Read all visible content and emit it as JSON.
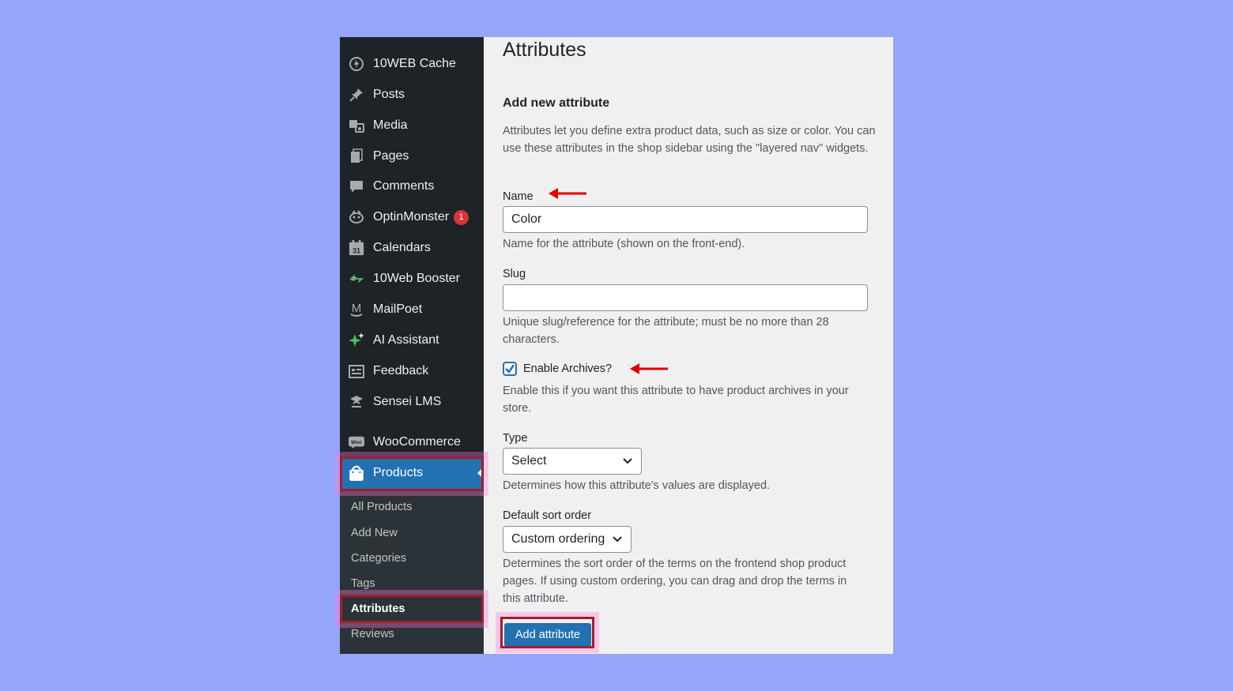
{
  "sidebar": {
    "items": [
      {
        "label": "10WEB Cache",
        "icon": "gauge-icon"
      },
      {
        "label": "Posts",
        "icon": "pin-icon"
      },
      {
        "label": "Media",
        "icon": "media-icon"
      },
      {
        "label": "Pages",
        "icon": "pages-icon"
      },
      {
        "label": "Comments",
        "icon": "comment-icon"
      },
      {
        "label": "OptinMonster",
        "icon": "optinmonster-icon",
        "badge": "1"
      },
      {
        "label": "Calendars",
        "icon": "calendar-icon",
        "icon_text": "31"
      },
      {
        "label": "10Web Booster",
        "icon": "booster-icon"
      },
      {
        "label": "MailPoet",
        "icon": "mailpoet-icon",
        "icon_text": "M"
      },
      {
        "label": "AI Assistant",
        "icon": "sparkle-icon"
      },
      {
        "label": "Feedback",
        "icon": "feedback-icon"
      },
      {
        "label": "Sensei LMS",
        "icon": "sensei-icon"
      },
      {
        "label": "WooCommerce",
        "icon": "woocommerce-icon",
        "icon_text": "Woo"
      }
    ],
    "active": {
      "label": "Products",
      "icon": "bag-icon"
    },
    "submenu": [
      {
        "label": "All Products"
      },
      {
        "label": "Add New"
      },
      {
        "label": "Categories"
      },
      {
        "label": "Tags"
      },
      {
        "label": "Attributes",
        "current": true
      },
      {
        "label": "Reviews"
      }
    ]
  },
  "main": {
    "title": "Attributes",
    "section_title": "Add new attribute",
    "intro": "Attributes let you define extra product data, such as size or color. You can use these attributes in the shop sidebar using the \"layered nav\" widgets.",
    "name": {
      "label": "Name",
      "value": "Color",
      "help": "Name for the attribute (shown on the front-end)."
    },
    "slug": {
      "label": "Slug",
      "value": "",
      "help": "Unique slug/reference for the attribute; must be no more than 28 characters."
    },
    "archives": {
      "label": "Enable Archives?",
      "checked": true,
      "help": "Enable this if you want this attribute to have product archives in your store."
    },
    "type": {
      "label": "Type",
      "selected": "Select",
      "help": "Determines how this attribute's values are displayed."
    },
    "sort": {
      "label": "Default sort order",
      "selected": "Custom ordering",
      "help": "Determines the sort order of the terms on the frontend shop product pages. If using custom ordering, you can drag and drop the terms in this attribute."
    },
    "submit_label": "Add attribute"
  },
  "colors": {
    "page_bg": "#95a5f8",
    "sidebar_bg": "#1d2327",
    "submenu_bg": "#2c3338",
    "accent": "#2271b1",
    "highlight": "#a01e2a",
    "arrow": "#e00000",
    "badge": "#d63638"
  }
}
